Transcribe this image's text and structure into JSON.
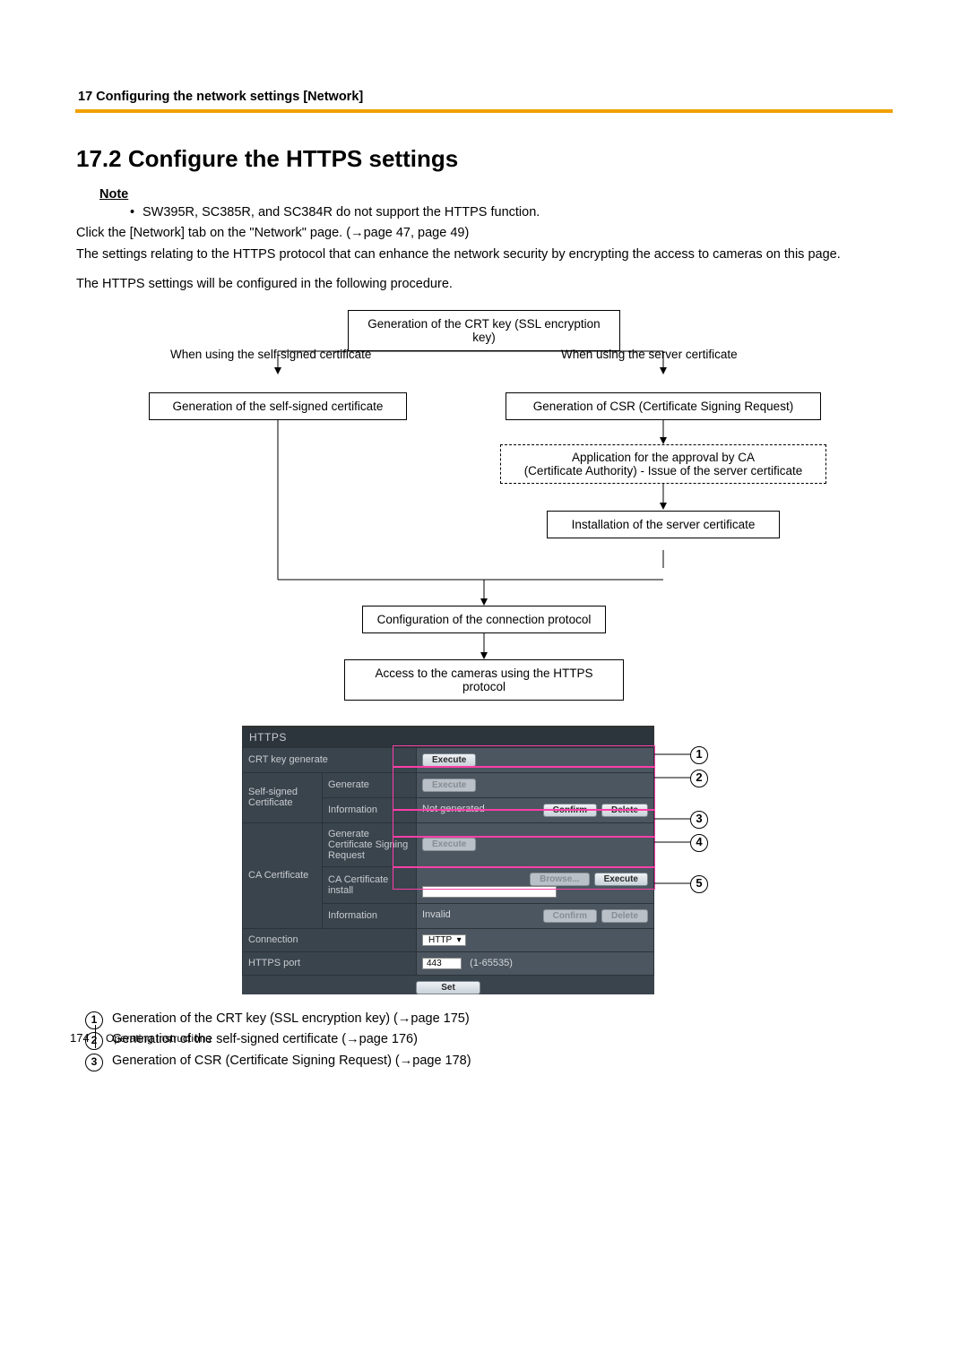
{
  "header": {
    "running": "17 Configuring the network settings [Network]"
  },
  "title": "17.2  Configure the HTTPS settings",
  "note_label": "Note",
  "note_items": [
    "SW395R, SC385R, and SC384R do not support the HTTPS function."
  ],
  "body1a": "Click the [Network] tab on the \"Network\" page. (",
  "body1b": "page 47, page 49)",
  "body2": "The settings relating to the HTTPS protocol that can enhance the network security by encrypting the access to cameras on this page.",
  "body3": "The HTTPS settings will be configured in the following procedure.",
  "flow": {
    "crt": "Generation of the CRT key (SSL encryption key)",
    "label_self": "When using the self-signed certificate",
    "label_srv": "When using the server certificate",
    "self_gen": "Generation of the self-signed certificate",
    "csr": "Generation of CSR (Certificate Signing Request)",
    "ca1": "Application for the approval by CA",
    "ca2": "(Certificate Authority) - Issue of the server certificate",
    "install": "Installation of the server certificate",
    "config": "Configuration of the connection protocol",
    "access": "Access to the cameras using the HTTPS protocol"
  },
  "ss": {
    "title": "HTTPS",
    "row_crt": "CRT key generate",
    "row_self": "Self-signed Certificate",
    "self_gen": "Generate",
    "self_info": "Information",
    "self_info_val": "Not generated",
    "row_ca": "CA Certificate",
    "ca_csr": "Generate Certificate Signing Request",
    "ca_inst": "CA Certificate install",
    "ca_info": "Information",
    "ca_info_val": "Invalid",
    "conn": "Connection",
    "conn_val": "HTTP",
    "port": "HTTPS port",
    "port_val": "443",
    "port_hint": "(1-65535)",
    "btn_exec": "Execute",
    "btn_conf": "Confirm",
    "btn_del": "Delete",
    "btn_browse": "Browse...",
    "btn_set": "Set"
  },
  "callouts": {
    "c1": "Generation of the CRT key (SSL encryption key) (",
    "c1b": "page 175)",
    "c2": "Generation of the self-signed certificate (",
    "c2b": "page 176)",
    "c3": "Generation of CSR (Certificate Signing Request) (",
    "c3b": "page 178)"
  },
  "footer": {
    "page_num": "174",
    "doc": "Operating Instructions"
  },
  "glyphs": {
    "arrow": "→",
    "tri": "▾"
  }
}
